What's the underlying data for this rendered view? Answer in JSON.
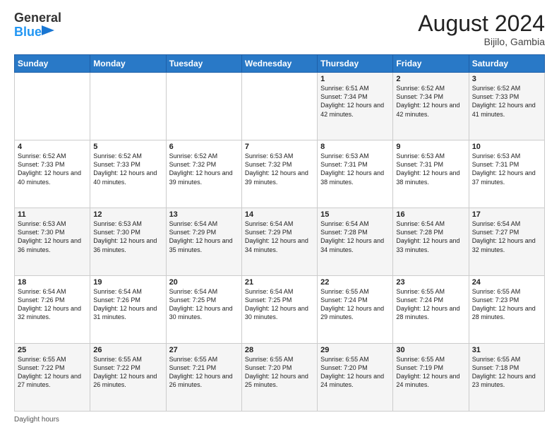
{
  "header": {
    "logo_line1": "General",
    "logo_line2": "Blue",
    "title": "August 2024",
    "subtitle": "Bijilo, Gambia"
  },
  "days_of_week": [
    "Sunday",
    "Monday",
    "Tuesday",
    "Wednesday",
    "Thursday",
    "Friday",
    "Saturday"
  ],
  "footer": {
    "daylight_label": "Daylight hours"
  },
  "weeks": [
    [
      {
        "day": "",
        "sunrise": "",
        "sunset": "",
        "daylight": "",
        "empty": true
      },
      {
        "day": "",
        "sunrise": "",
        "sunset": "",
        "daylight": "",
        "empty": true
      },
      {
        "day": "",
        "sunrise": "",
        "sunset": "",
        "daylight": "",
        "empty": true
      },
      {
        "day": "",
        "sunrise": "",
        "sunset": "",
        "daylight": "",
        "empty": true
      },
      {
        "day": "1",
        "sunrise": "Sunrise: 6:51 AM",
        "sunset": "Sunset: 7:34 PM",
        "daylight": "Daylight: 12 hours and 42 minutes.",
        "empty": false
      },
      {
        "day": "2",
        "sunrise": "Sunrise: 6:52 AM",
        "sunset": "Sunset: 7:34 PM",
        "daylight": "Daylight: 12 hours and 42 minutes.",
        "empty": false
      },
      {
        "day": "3",
        "sunrise": "Sunrise: 6:52 AM",
        "sunset": "Sunset: 7:33 PM",
        "daylight": "Daylight: 12 hours and 41 minutes.",
        "empty": false
      }
    ],
    [
      {
        "day": "4",
        "sunrise": "Sunrise: 6:52 AM",
        "sunset": "Sunset: 7:33 PM",
        "daylight": "Daylight: 12 hours and 40 minutes.",
        "empty": false
      },
      {
        "day": "5",
        "sunrise": "Sunrise: 6:52 AM",
        "sunset": "Sunset: 7:33 PM",
        "daylight": "Daylight: 12 hours and 40 minutes.",
        "empty": false
      },
      {
        "day": "6",
        "sunrise": "Sunrise: 6:52 AM",
        "sunset": "Sunset: 7:32 PM",
        "daylight": "Daylight: 12 hours and 39 minutes.",
        "empty": false
      },
      {
        "day": "7",
        "sunrise": "Sunrise: 6:53 AM",
        "sunset": "Sunset: 7:32 PM",
        "daylight": "Daylight: 12 hours and 39 minutes.",
        "empty": false
      },
      {
        "day": "8",
        "sunrise": "Sunrise: 6:53 AM",
        "sunset": "Sunset: 7:31 PM",
        "daylight": "Daylight: 12 hours and 38 minutes.",
        "empty": false
      },
      {
        "day": "9",
        "sunrise": "Sunrise: 6:53 AM",
        "sunset": "Sunset: 7:31 PM",
        "daylight": "Daylight: 12 hours and 38 minutes.",
        "empty": false
      },
      {
        "day": "10",
        "sunrise": "Sunrise: 6:53 AM",
        "sunset": "Sunset: 7:31 PM",
        "daylight": "Daylight: 12 hours and 37 minutes.",
        "empty": false
      }
    ],
    [
      {
        "day": "11",
        "sunrise": "Sunrise: 6:53 AM",
        "sunset": "Sunset: 7:30 PM",
        "daylight": "Daylight: 12 hours and 36 minutes.",
        "empty": false
      },
      {
        "day": "12",
        "sunrise": "Sunrise: 6:53 AM",
        "sunset": "Sunset: 7:30 PM",
        "daylight": "Daylight: 12 hours and 36 minutes.",
        "empty": false
      },
      {
        "day": "13",
        "sunrise": "Sunrise: 6:54 AM",
        "sunset": "Sunset: 7:29 PM",
        "daylight": "Daylight: 12 hours and 35 minutes.",
        "empty": false
      },
      {
        "day": "14",
        "sunrise": "Sunrise: 6:54 AM",
        "sunset": "Sunset: 7:29 PM",
        "daylight": "Daylight: 12 hours and 34 minutes.",
        "empty": false
      },
      {
        "day": "15",
        "sunrise": "Sunrise: 6:54 AM",
        "sunset": "Sunset: 7:28 PM",
        "daylight": "Daylight: 12 hours and 34 minutes.",
        "empty": false
      },
      {
        "day": "16",
        "sunrise": "Sunrise: 6:54 AM",
        "sunset": "Sunset: 7:28 PM",
        "daylight": "Daylight: 12 hours and 33 minutes.",
        "empty": false
      },
      {
        "day": "17",
        "sunrise": "Sunrise: 6:54 AM",
        "sunset": "Sunset: 7:27 PM",
        "daylight": "Daylight: 12 hours and 32 minutes.",
        "empty": false
      }
    ],
    [
      {
        "day": "18",
        "sunrise": "Sunrise: 6:54 AM",
        "sunset": "Sunset: 7:26 PM",
        "daylight": "Daylight: 12 hours and 32 minutes.",
        "empty": false
      },
      {
        "day": "19",
        "sunrise": "Sunrise: 6:54 AM",
        "sunset": "Sunset: 7:26 PM",
        "daylight": "Daylight: 12 hours and 31 minutes.",
        "empty": false
      },
      {
        "day": "20",
        "sunrise": "Sunrise: 6:54 AM",
        "sunset": "Sunset: 7:25 PM",
        "daylight": "Daylight: 12 hours and 30 minutes.",
        "empty": false
      },
      {
        "day": "21",
        "sunrise": "Sunrise: 6:54 AM",
        "sunset": "Sunset: 7:25 PM",
        "daylight": "Daylight: 12 hours and 30 minutes.",
        "empty": false
      },
      {
        "day": "22",
        "sunrise": "Sunrise: 6:55 AM",
        "sunset": "Sunset: 7:24 PM",
        "daylight": "Daylight: 12 hours and 29 minutes.",
        "empty": false
      },
      {
        "day": "23",
        "sunrise": "Sunrise: 6:55 AM",
        "sunset": "Sunset: 7:24 PM",
        "daylight": "Daylight: 12 hours and 28 minutes.",
        "empty": false
      },
      {
        "day": "24",
        "sunrise": "Sunrise: 6:55 AM",
        "sunset": "Sunset: 7:23 PM",
        "daylight": "Daylight: 12 hours and 28 minutes.",
        "empty": false
      }
    ],
    [
      {
        "day": "25",
        "sunrise": "Sunrise: 6:55 AM",
        "sunset": "Sunset: 7:22 PM",
        "daylight": "Daylight: 12 hours and 27 minutes.",
        "empty": false
      },
      {
        "day": "26",
        "sunrise": "Sunrise: 6:55 AM",
        "sunset": "Sunset: 7:22 PM",
        "daylight": "Daylight: 12 hours and 26 minutes.",
        "empty": false
      },
      {
        "day": "27",
        "sunrise": "Sunrise: 6:55 AM",
        "sunset": "Sunset: 7:21 PM",
        "daylight": "Daylight: 12 hours and 26 minutes.",
        "empty": false
      },
      {
        "day": "28",
        "sunrise": "Sunrise: 6:55 AM",
        "sunset": "Sunset: 7:20 PM",
        "daylight": "Daylight: 12 hours and 25 minutes.",
        "empty": false
      },
      {
        "day": "29",
        "sunrise": "Sunrise: 6:55 AM",
        "sunset": "Sunset: 7:20 PM",
        "daylight": "Daylight: 12 hours and 24 minutes.",
        "empty": false
      },
      {
        "day": "30",
        "sunrise": "Sunrise: 6:55 AM",
        "sunset": "Sunset: 7:19 PM",
        "daylight": "Daylight: 12 hours and 24 minutes.",
        "empty": false
      },
      {
        "day": "31",
        "sunrise": "Sunrise: 6:55 AM",
        "sunset": "Sunset: 7:18 PM",
        "daylight": "Daylight: 12 hours and 23 minutes.",
        "empty": false
      }
    ]
  ]
}
